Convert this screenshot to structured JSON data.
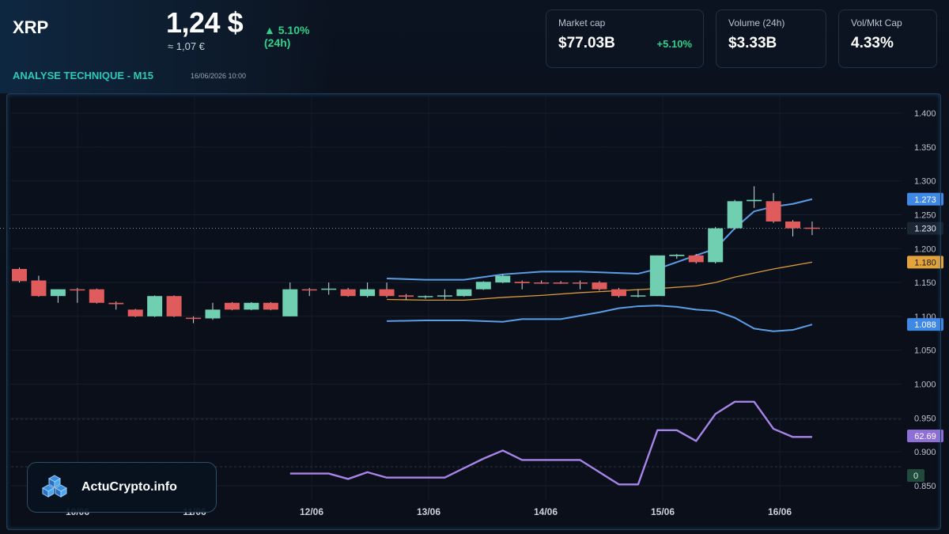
{
  "header": {
    "symbol": "XRP",
    "price": "1,24 $",
    "price_eur": "≈ 1,07 €",
    "change_24h": "▲ 5.10% (24h)",
    "section_title": "ANALYSE TECHNIQUE - M15",
    "timestamp": "16/06/2026 10:00"
  },
  "stats": [
    {
      "label": "Market cap",
      "value": "$77.03B",
      "change": "+5.10%"
    },
    {
      "label": "Volume (24h)",
      "value": "$3.33B",
      "change": ""
    },
    {
      "label": "Vol/Mkt Cap",
      "value": "4.33%",
      "change": ""
    }
  ],
  "brand": {
    "name": "ActuCrypto.info"
  },
  "colors": {
    "up": "#6fcfb0",
    "down": "#e05c5c",
    "bollinger": "#5b9ee8",
    "ma": "#d99a3a",
    "rsi": "#a784e8"
  },
  "chart_data": {
    "type": "candlestick",
    "x_tick_labels": [
      "10/06",
      "11/06",
      "12/06",
      "13/06",
      "14/06",
      "15/06",
      "16/06"
    ],
    "y_ticks": [
      "1.400",
      "1.350",
      "1.300",
      "1.250",
      "1.200",
      "1.150",
      "1.100",
      "1.050",
      "1.000",
      "0.950",
      "0.900",
      "0.850"
    ],
    "ylim": [
      0.84,
      1.41
    ],
    "current_price": 1.23,
    "price_labels": [
      {
        "value": "1.273",
        "series": "bollinger_upper"
      },
      {
        "value": "1.230",
        "series": "price"
      },
      {
        "value": "1.180",
        "series": "moving_average"
      },
      {
        "value": "1.088",
        "series": "bollinger_lower"
      },
      {
        "value": "62.69",
        "series": "rsi"
      },
      {
        "value": "0",
        "series": "volume"
      }
    ],
    "candles": [
      {
        "x": 0.0,
        "o": 1.17,
        "h": 1.172,
        "c": 1.152,
        "l": 1.15
      },
      {
        "x": 1.0,
        "o": 1.153,
        "h": 1.16,
        "c": 1.13,
        "l": 1.129
      },
      {
        "x": 2.0,
        "o": 1.13,
        "h": 1.14,
        "c": 1.14,
        "l": 1.12
      },
      {
        "x": 3.0,
        "o": 1.14,
        "h": 1.142,
        "c": 1.139,
        "l": 1.12
      },
      {
        "x": 4.0,
        "o": 1.14,
        "h": 1.141,
        "c": 1.12,
        "l": 1.119
      },
      {
        "x": 5.0,
        "o": 1.12,
        "h": 1.122,
        "c": 1.118,
        "l": 1.11
      },
      {
        "x": 6.0,
        "o": 1.11,
        "h": 1.111,
        "c": 1.1,
        "l": 1.099
      },
      {
        "x": 7.0,
        "o": 1.1,
        "h": 1.131,
        "c": 1.13,
        "l": 1.099
      },
      {
        "x": 8.0,
        "o": 1.13,
        "h": 1.131,
        "c": 1.1,
        "l": 1.099
      },
      {
        "x": 9.0,
        "o": 1.098,
        "h": 1.1,
        "c": 1.097,
        "l": 1.09
      },
      {
        "x": 10.0,
        "o": 1.097,
        "h": 1.12,
        "c": 1.11,
        "l": 1.095
      },
      {
        "x": 11.0,
        "o": 1.12,
        "h": 1.121,
        "c": 1.11,
        "l": 1.109
      },
      {
        "x": 12.0,
        "o": 1.11,
        "h": 1.121,
        "c": 1.12,
        "l": 1.109
      },
      {
        "x": 13.0,
        "o": 1.12,
        "h": 1.121,
        "c": 1.11,
        "l": 1.109
      },
      {
        "x": 14.0,
        "o": 1.1,
        "h": 1.15,
        "c": 1.14,
        "l": 1.1
      },
      {
        "x": 15.0,
        "o": 1.14,
        "h": 1.142,
        "c": 1.139,
        "l": 1.13
      },
      {
        "x": 16.0,
        "o": 1.14,
        "h": 1.15,
        "c": 1.141,
        "l": 1.132
      },
      {
        "x": 17.0,
        "o": 1.14,
        "h": 1.142,
        "c": 1.13,
        "l": 1.129
      },
      {
        "x": 18.0,
        "o": 1.13,
        "h": 1.15,
        "c": 1.14,
        "l": 1.128
      },
      {
        "x": 19.0,
        "o": 1.14,
        "h": 1.15,
        "c": 1.13,
        "l": 1.128
      },
      {
        "x": 20.0,
        "o": 1.131,
        "h": 1.133,
        "c": 1.129,
        "l": 1.125
      },
      {
        "x": 21.0,
        "o": 1.129,
        "h": 1.131,
        "c": 1.13,
        "l": 1.126
      },
      {
        "x": 22.0,
        "o": 1.13,
        "h": 1.14,
        "c": 1.131,
        "l": 1.125
      },
      {
        "x": 23.0,
        "o": 1.13,
        "h": 1.14,
        "c": 1.14,
        "l": 1.129
      },
      {
        "x": 24.0,
        "o": 1.14,
        "h": 1.152,
        "c": 1.151,
        "l": 1.139
      },
      {
        "x": 25.0,
        "o": 1.15,
        "h": 1.162,
        "c": 1.16,
        "l": 1.149
      },
      {
        "x": 26.0,
        "o": 1.151,
        "h": 1.153,
        "c": 1.149,
        "l": 1.14
      },
      {
        "x": 27.0,
        "o": 1.15,
        "h": 1.153,
        "c": 1.149,
        "l": 1.148
      },
      {
        "x": 28.0,
        "o": 1.15,
        "h": 1.152,
        "c": 1.149,
        "l": 1.148
      },
      {
        "x": 29.0,
        "o": 1.15,
        "h": 1.153,
        "c": 1.149,
        "l": 1.14
      },
      {
        "x": 30.0,
        "o": 1.15,
        "h": 1.152,
        "c": 1.14,
        "l": 1.138
      },
      {
        "x": 31.0,
        "o": 1.14,
        "h": 1.142,
        "c": 1.13,
        "l": 1.128
      },
      {
        "x": 32.0,
        "o": 1.13,
        "h": 1.14,
        "c": 1.131,
        "l": 1.128
      },
      {
        "x": 33.0,
        "o": 1.13,
        "h": 1.19,
        "c": 1.19,
        "l": 1.13
      },
      {
        "x": 34.0,
        "o": 1.189,
        "h": 1.192,
        "c": 1.191,
        "l": 1.185
      },
      {
        "x": 35.0,
        "o": 1.19,
        "h": 1.192,
        "c": 1.18,
        "l": 1.178
      },
      {
        "x": 36.0,
        "o": 1.18,
        "h": 1.232,
        "c": 1.23,
        "l": 1.178
      },
      {
        "x": 37.0,
        "o": 1.23,
        "h": 1.272,
        "c": 1.27,
        "l": 1.228
      },
      {
        "x": 38.0,
        "o": 1.27,
        "h": 1.292,
        "c": 1.272,
        "l": 1.26
      },
      {
        "x": 39.0,
        "o": 1.27,
        "h": 1.282,
        "c": 1.24,
        "l": 1.238
      },
      {
        "x": 40.0,
        "o": 1.24,
        "h": 1.242,
        "c": 1.23,
        "l": 1.218
      },
      {
        "x": 41.0,
        "o": 1.231,
        "h": 1.24,
        "c": 1.23,
        "l": 1.22
      }
    ],
    "bollinger_upper": {
      "x": [
        19,
        21,
        23,
        25,
        27,
        29,
        31,
        32,
        33,
        35,
        36,
        37,
        38,
        39,
        40,
        41
      ],
      "values": [
        1.156,
        1.154,
        1.154,
        1.162,
        1.166,
        1.166,
        1.164,
        1.163,
        1.17,
        1.19,
        1.2,
        1.23,
        1.255,
        1.262,
        1.266,
        1.273
      ]
    },
    "bollinger_lower": {
      "x": [
        19,
        21,
        23,
        25,
        26,
        28,
        30,
        31,
        32,
        33,
        34,
        35,
        36,
        37,
        38,
        39,
        40,
        41
      ],
      "values": [
        1.093,
        1.094,
        1.094,
        1.092,
        1.096,
        1.096,
        1.106,
        1.112,
        1.115,
        1.116,
        1.114,
        1.11,
        1.108,
        1.098,
        1.082,
        1.078,
        1.08,
        1.088
      ]
    },
    "moving_average": {
      "x": [
        19,
        21,
        23,
        25,
        27,
        29,
        31,
        33,
        35,
        36,
        37,
        38,
        39,
        40,
        41
      ],
      "values": [
        1.125,
        1.124,
        1.124,
        1.128,
        1.131,
        1.135,
        1.138,
        1.141,
        1.145,
        1.15,
        1.158,
        1.164,
        1.17,
        1.175,
        1.18
      ]
    },
    "rsi": {
      "x": [
        14,
        15,
        16,
        17,
        18,
        19,
        20,
        21,
        22,
        23,
        24,
        25,
        26,
        27,
        28,
        29,
        30,
        31,
        32,
        33,
        34,
        35,
        36,
        37,
        38,
        39,
        40,
        41
      ],
      "values": [
        0.868,
        0.868,
        0.868,
        0.86,
        0.87,
        0.862,
        0.862,
        0.862,
        0.862,
        0.876,
        0.89,
        0.902,
        0.888,
        0.888,
        0.888,
        0.888,
        0.87,
        0.852,
        0.852,
        0.932,
        0.932,
        0.916,
        0.956,
        0.974,
        0.974,
        0.934,
        0.922,
        0.922
      ]
    }
  }
}
